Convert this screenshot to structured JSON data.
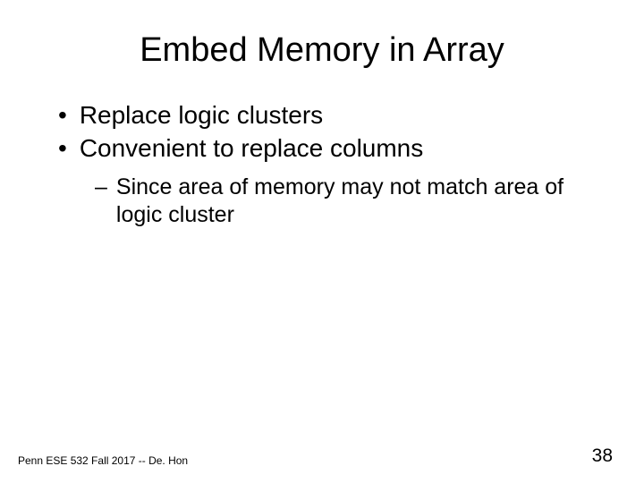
{
  "title": "Embed Memory in Array",
  "bullets": {
    "b1": "Replace logic clusters",
    "b2": "Convenient to replace columns",
    "sub1": "Since area of memory may not match area of logic cluster"
  },
  "footer": {
    "left": "Penn ESE 532 Fall 2017 -- De. Hon",
    "pageNumber": "38"
  }
}
